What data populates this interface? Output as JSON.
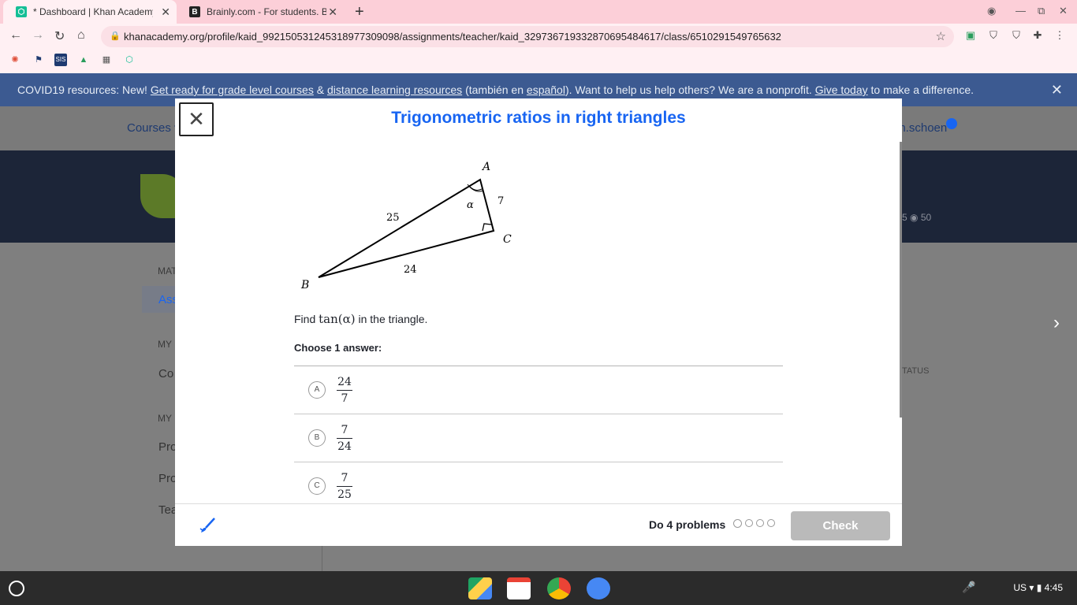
{
  "browser": {
    "tabs": [
      {
        "title": "* Dashboard | Khan Academy",
        "favicon": "khan-academy-icon"
      },
      {
        "title": "Brainly.com - For students. By students",
        "favicon": "brainly-icon"
      }
    ],
    "url": "khanacademy.org/profile/kaid_992150531245318977309098/assignments/teacher/kaid_329736719332870695484617/class/6510291549765632"
  },
  "banner": {
    "prefix": "COVID19 resources: New! ",
    "link1": "Get ready for grade level courses",
    "amp": " & ",
    "link2": "distance learning resources",
    "mid": " (también en ",
    "link3": "español",
    "mid2": "). Want to help us help others? We are a nonprofit. ",
    "link4": "Give today",
    "suffix": " to make a difference."
  },
  "ka_nav": {
    "courses": "Courses ▾",
    "user": "gh.schoen"
  },
  "hero": {
    "points": "5  ◉ 50"
  },
  "sidebar": {
    "label1": "MAT",
    "item1": "Ass",
    "label2": "MY",
    "item2": "Co",
    "label3": "MY",
    "item3": "Pro",
    "item4": "Pro",
    "item5": "Tea"
  },
  "table": {
    "status_header": "TATUS"
  },
  "modal": {
    "title": "Trigonometric ratios in right triangles",
    "triangle": {
      "vertex_a": "A",
      "vertex_b": "B",
      "vertex_c": "C",
      "side_ab": "25",
      "side_ac": "7",
      "side_bc": "24",
      "angle": "α"
    },
    "prompt_pre": "Find ",
    "prompt_math": "tan(α)",
    "prompt_post": " in the triangle.",
    "choose": "Choose 1 answer:",
    "choices": [
      {
        "letter": "A",
        "num": "24",
        "den": "7"
      },
      {
        "letter": "B",
        "num": "7",
        "den": "24"
      },
      {
        "letter": "C",
        "num": "7",
        "den": "25"
      }
    ],
    "footer": {
      "do_problems": "Do 4 problems",
      "check": "Check"
    }
  },
  "shelf": {
    "tray": "US  ▾  ▮  4:45"
  },
  "colors": {
    "accent": "#1865f2",
    "tabbar": "#fccfd8",
    "banner": "#3c5a91"
  }
}
